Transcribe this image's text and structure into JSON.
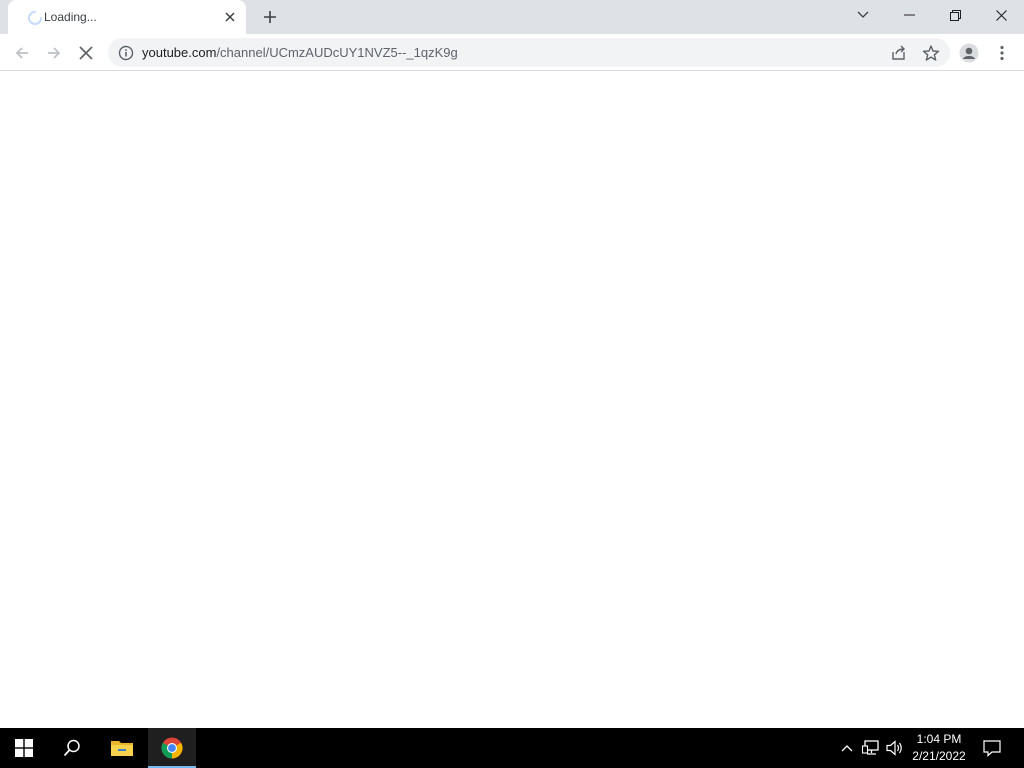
{
  "browser": {
    "tab": {
      "title": "Loading...",
      "loading_icon": "spinner-icon",
      "close_icon": "close-icon"
    },
    "new_tab_icon": "plus-icon",
    "window_controls": [
      "tab-search-icon",
      "minimize-icon",
      "restore-icon",
      "close-icon"
    ],
    "toolbar": {
      "back_icon": "back-arrow-icon",
      "forward_icon": "forward-arrow-icon",
      "stop_icon": "stop-icon",
      "menu_icon": "kebab-menu-icon",
      "profile_icon": "profile-avatar-icon"
    },
    "omnibox": {
      "info_icon": "info-icon",
      "url_host": "youtube.com",
      "url_path": "/channel/UCmzAUDcUY1NVZ5--_1qzK9g",
      "share_icon": "share-icon",
      "bookmark_icon": "star-icon"
    }
  },
  "taskbar": {
    "items": [
      "windows-start-icon",
      "search-icon",
      "file-explorer-icon",
      "chrome-icon"
    ],
    "active_item": "chrome-icon",
    "tray_icons": [
      "chevron-up-icon",
      "network-icon",
      "volume-icon",
      "notification-icon"
    ],
    "clock": {
      "time": "1:04 PM",
      "date": "2/21/2022"
    }
  },
  "colors": {
    "tabstrip_bg": "#dee1e6",
    "omnibox_bg": "#f1f3f4",
    "taskbar_bg": "#000000",
    "active_indicator": "#76b9ed"
  }
}
